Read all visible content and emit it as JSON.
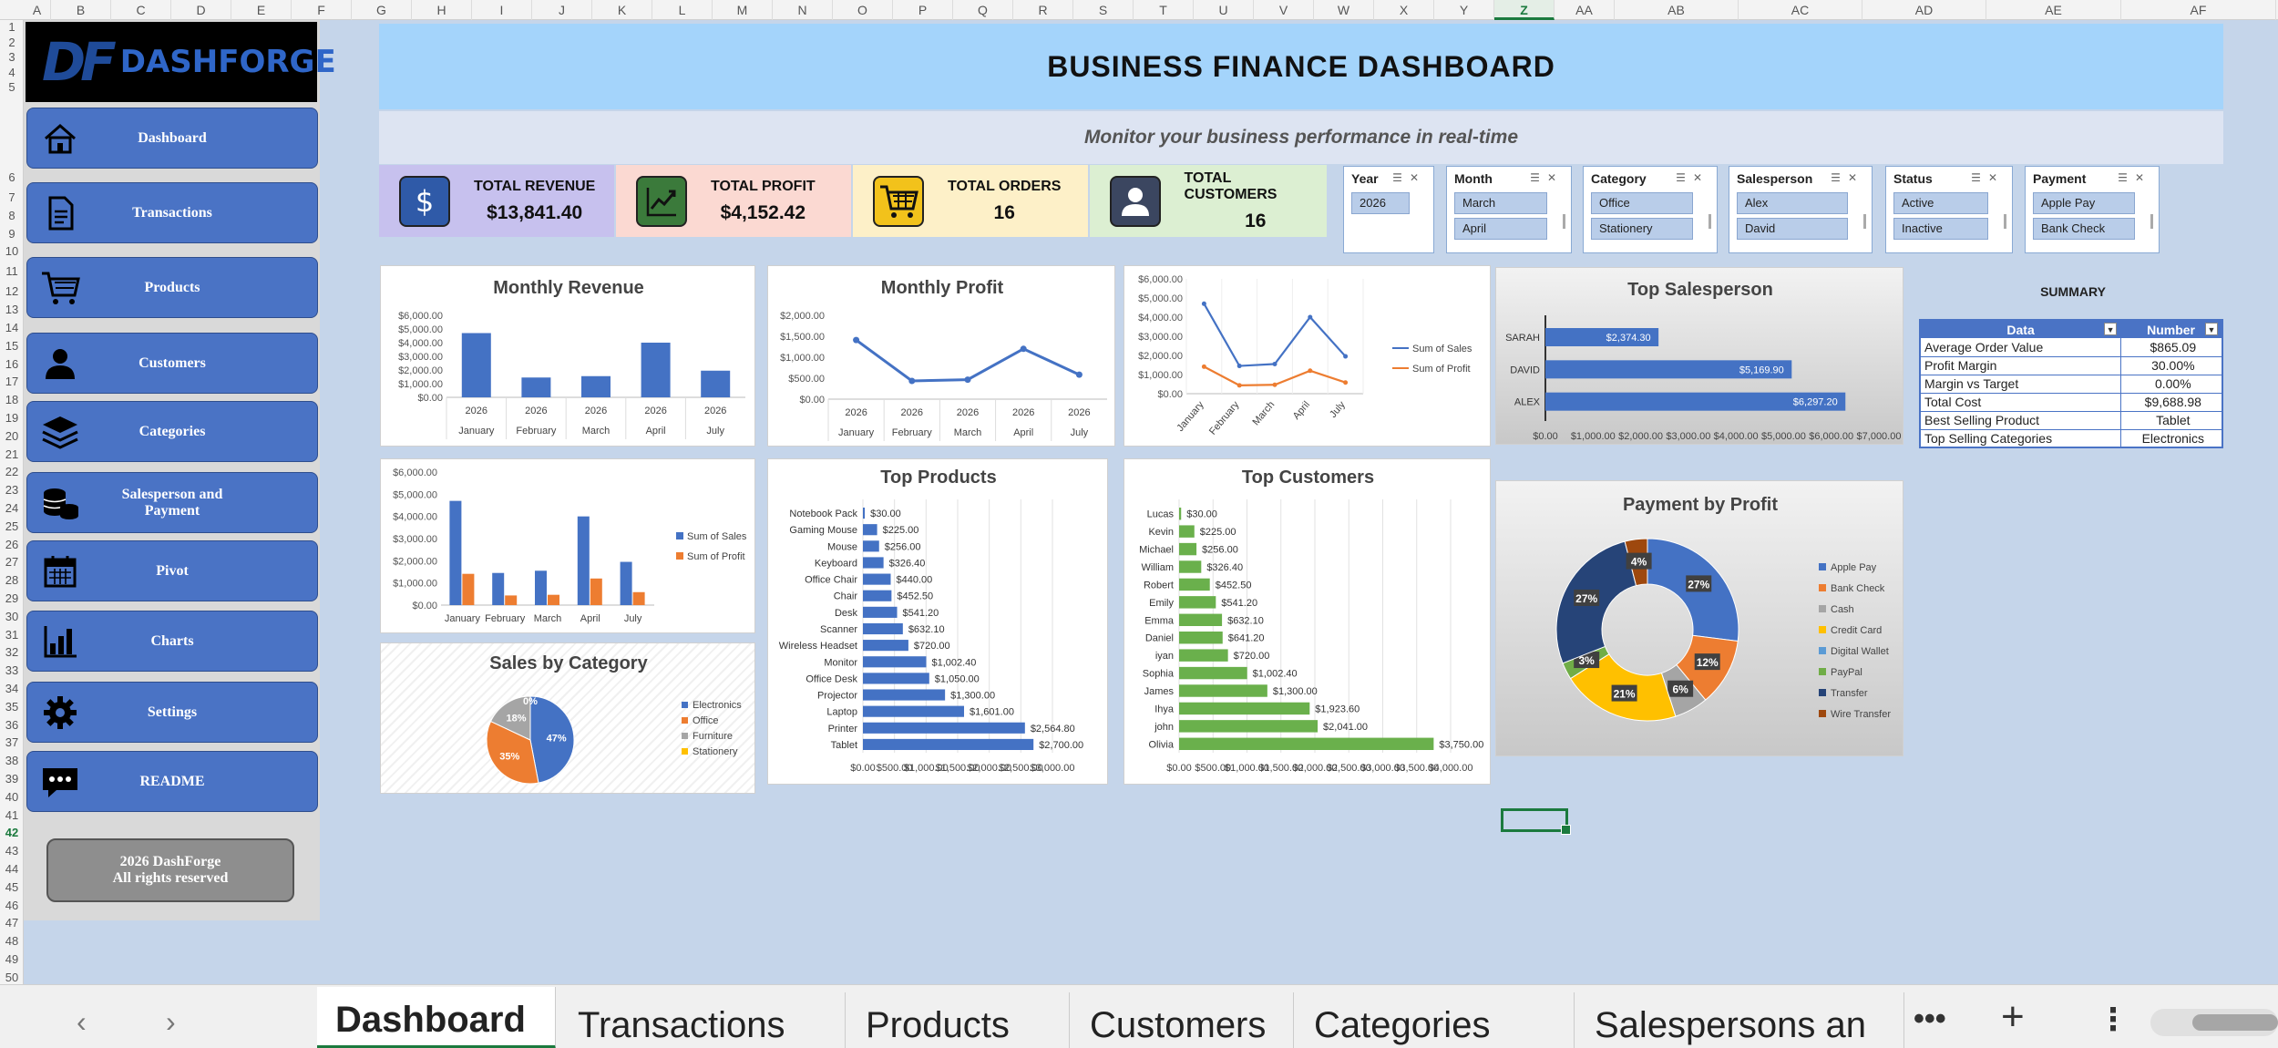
{
  "sheet": {
    "columns": [
      "A",
      "B",
      "C",
      "D",
      "E",
      "F",
      "G",
      "H",
      "I",
      "J",
      "K",
      "L",
      "M",
      "N",
      "O",
      "P",
      "Q",
      "R",
      "S",
      "T",
      "U",
      "V",
      "W",
      "X",
      "Y",
      "Z",
      "AA",
      "AB",
      "AC",
      "AD",
      "AE",
      "AF"
    ],
    "active_column": "Z",
    "rows": [
      "1",
      "2",
      "3",
      "4",
      "5",
      "6",
      "7",
      "8",
      "9",
      "10",
      "11",
      "12",
      "13",
      "14",
      "15",
      "16",
      "17",
      "18",
      "19",
      "20",
      "21",
      "22",
      "23",
      "24",
      "25",
      "26",
      "27",
      "28",
      "29",
      "30",
      "31",
      "32",
      "33",
      "34",
      "35",
      "36",
      "37",
      "38",
      "39",
      "40",
      "41",
      "42",
      "43",
      "44",
      "45",
      "46",
      "47",
      "48",
      "49",
      "50"
    ],
    "active_row": "42"
  },
  "logo": {
    "mark": "DF",
    "text": "DASHFORGE"
  },
  "nav": [
    {
      "label": "Dashboard",
      "icon": "home-icon"
    },
    {
      "label": "Transactions",
      "icon": "document-icon"
    },
    {
      "label": "Products",
      "icon": "cart-icon"
    },
    {
      "label": "Customers",
      "icon": "user-icon"
    },
    {
      "label": "Categories",
      "icon": "layers-icon"
    },
    {
      "label": "Salesperson and Payment",
      "icon": "coins-icon"
    },
    {
      "label": "Pivot",
      "icon": "calendar-icon"
    },
    {
      "label": "Charts",
      "icon": "bar-chart-icon"
    },
    {
      "label": "Settings",
      "icon": "gear-icon"
    },
    {
      "label": "README",
      "icon": "chat-icon"
    }
  ],
  "copyright": {
    "line1": "2026 DashForge",
    "line2": "All rights reserved"
  },
  "header": {
    "title": "BUSINESS FINANCE DASHBOARD",
    "subtitle": "Monitor your business performance in real-time"
  },
  "kpis": [
    {
      "label": "TOTAL REVENUE",
      "value": "$13,841.40",
      "bg": "#c7c1ee",
      "icon_bg": "#2f5aa8"
    },
    {
      "label": "TOTAL PROFIT",
      "value": "$4,152.42",
      "bg": "#fbd9d2",
      "icon_bg": "#3b7a3b"
    },
    {
      "label": "TOTAL ORDERS",
      "value": "16",
      "bg": "#fdf0c8",
      "icon_bg": "#f2c21b"
    },
    {
      "label": "TOTAL CUSTOMERS",
      "value": "16",
      "bg": "#dcefd2",
      "icon_bg": "#3b4660"
    }
  ],
  "slicers": [
    {
      "title": "Year",
      "items": [
        "2026"
      ]
    },
    {
      "title": "Month",
      "items": [
        "March",
        "April"
      ]
    },
    {
      "title": "Category",
      "items": [
        "Office",
        "Stationery"
      ]
    },
    {
      "title": "Salesperson",
      "items": [
        "Alex",
        "David"
      ]
    },
    {
      "title": "Status",
      "items": [
        "Active",
        "Inactive"
      ]
    },
    {
      "title": "Payment",
      "items": [
        "Apple Pay",
        "Bank Check"
      ]
    }
  ],
  "summary": {
    "title": "SUMMARY",
    "headers": [
      "Data",
      "Number"
    ],
    "rows": [
      [
        "Average Order Value",
        "$865.09"
      ],
      [
        "Profit Margin",
        "30.00%"
      ],
      [
        "Margin vs Target",
        "0.00%"
      ],
      [
        "Total Cost",
        "$9,688.98"
      ],
      [
        "Best Selling Product",
        "Tablet"
      ],
      [
        "Top Selling Categories",
        "Electronics"
      ]
    ]
  },
  "tabs": [
    "Dashboard",
    "Transactions",
    "Products",
    "Customers",
    "Categories",
    "Salespersons an"
  ],
  "tab_controls": {
    "prev": "‹",
    "next": "›",
    "more": "•••",
    "add": "+",
    "options": "⋮"
  },
  "colors": {
    "blue": "#4472c4",
    "orange": "#ed7d31",
    "grey": "#a5a5a5",
    "yellow": "#ffc000",
    "green": "#70ad47",
    "navy": "#264478",
    "brown": "#9e480e",
    "lightblue": "#5b9bd5"
  },
  "chart_data": [
    {
      "id": "monthly-revenue",
      "type": "bar",
      "title": "Monthly Revenue",
      "categories": [
        "January",
        "February",
        "March",
        "April",
        "July"
      ],
      "year_labels": [
        "2026",
        "2026",
        "2026",
        "2026",
        "2026"
      ],
      "values": [
        4700,
        1450,
        1550,
        4000,
        1950
      ],
      "ylim": [
        0,
        6000
      ],
      "yticks": [
        "$0.00",
        "$1,000.00",
        "$2,000.00",
        "$3,000.00",
        "$4,000.00",
        "$5,000.00",
        "$6,000.00"
      ]
    },
    {
      "id": "monthly-profit",
      "type": "line",
      "title": "Monthly Profit",
      "categories": [
        "January",
        "February",
        "March",
        "April",
        "July"
      ],
      "year_labels": [
        "2026",
        "2026",
        "2026",
        "2026",
        "2026"
      ],
      "values": [
        1410,
        435,
        465,
        1200,
        585
      ],
      "ylim": [
        0,
        2000
      ],
      "yticks": [
        "$0.00",
        "$500.00",
        "$1,000.00",
        "$1,500.00",
        "$2,000.00"
      ]
    },
    {
      "id": "sales-profit-line",
      "type": "line",
      "title": "",
      "categories": [
        "January",
        "February",
        "March",
        "April",
        "July"
      ],
      "series": [
        {
          "name": "Sum of Sales",
          "values": [
            4700,
            1450,
            1550,
            4000,
            1950
          ]
        },
        {
          "name": "Sum of Profit",
          "values": [
            1410,
            435,
            465,
            1200,
            585
          ]
        }
      ],
      "ylim": [
        0,
        6000
      ],
      "yticks": [
        "$0.00",
        "$1,000.00",
        "$2,000.00",
        "$3,000.00",
        "$4,000.00",
        "$5,000.00",
        "$6,000.00"
      ]
    },
    {
      "id": "top-salesperson",
      "type": "bar",
      "orientation": "horizontal",
      "title": "Top Salesperson",
      "categories": [
        "SARAH",
        "DAVID",
        "ALEX"
      ],
      "values": [
        2374.3,
        5169.9,
        6297.2
      ],
      "labels": [
        "$2,374.30",
        "$5,169.90",
        "$6,297.20"
      ],
      "xlim": [
        0,
        7000
      ],
      "xticks": [
        "$0.00",
        "$1,000.00",
        "$2,000.00",
        "$3,000.00",
        "$4,000.00",
        "$5,000.00",
        "$6,000.00",
        "$7,000.00"
      ]
    },
    {
      "id": "sales-profit-bar",
      "type": "bar",
      "title": "",
      "categories": [
        "January",
        "February",
        "March",
        "April",
        "July"
      ],
      "series": [
        {
          "name": "Sum of Sales",
          "values": [
            4700,
            1450,
            1550,
            4000,
            1950
          ]
        },
        {
          "name": "Sum of Profit",
          "values": [
            1410,
            435,
            465,
            1200,
            585
          ]
        }
      ],
      "ylim": [
        0,
        6000
      ],
      "yticks": [
        "$0.00",
        "$1,000.00",
        "$2,000.00",
        "$3,000.00",
        "$4,000.00",
        "$5,000.00",
        "$6,000.00"
      ]
    },
    {
      "id": "top-products",
      "type": "bar",
      "orientation": "horizontal",
      "title": "Top Products",
      "categories": [
        "Notebook Pack",
        "Gaming Mouse",
        "Mouse",
        "Keyboard",
        "Office Chair",
        "Chair",
        "Desk",
        "Scanner",
        "Wireless Headset",
        "Monitor",
        "Office Desk",
        "Projector",
        "Laptop",
        "Printer",
        "Tablet"
      ],
      "values": [
        30,
        225,
        256,
        326.4,
        440,
        452.5,
        541.2,
        632.1,
        720,
        1002.4,
        1050,
        1300,
        1601,
        2564.8,
        2700
      ],
      "labels": [
        "$30.00",
        "$225.00",
        "$256.00",
        "$326.40",
        "$440.00",
        "$452.50",
        "$541.20",
        "$632.10",
        "$720.00",
        "$1,002.40",
        "$1,050.00",
        "$1,300.00",
        "$1,601.00",
        "$2,564.80",
        "$2,700.00"
      ],
      "xlim": [
        0,
        3000
      ],
      "xticks": [
        "$0.00",
        "$500.00",
        "$1,000.00",
        "$1,500.00",
        "$2,000.00",
        "$2,500.00",
        "$3,000.00"
      ]
    },
    {
      "id": "top-customers",
      "type": "bar",
      "orientation": "horizontal",
      "title": "Top Customers",
      "categories": [
        "Lucas",
        "Kevin",
        "Michael",
        "William",
        "Robert",
        "Emily",
        "Emma",
        "Daniel",
        "iyan",
        "Sophia",
        "James",
        "Ihya",
        "john",
        "Olivia"
      ],
      "values": [
        30,
        225,
        256,
        326.4,
        452.5,
        541.2,
        632.1,
        641.2,
        720,
        1002.4,
        1300,
        1923.6,
        2041,
        3750
      ],
      "labels": [
        "$30.00",
        "$225.00",
        "$256.00",
        "$326.40",
        "$452.50",
        "$541.20",
        "$632.10",
        "$641.20",
        "$720.00",
        "$1,002.40",
        "$1,300.00",
        "$1,923.60",
        "$2,041.00",
        "$3,750.00"
      ],
      "xlim": [
        0,
        4000
      ],
      "xticks": [
        "$0.00",
        "$500.00",
        "$1,000.00",
        "$1,500.00",
        "$2,000.00",
        "$2,500.00",
        "$3,000.00",
        "$3,500.00",
        "$4,000.00"
      ]
    },
    {
      "id": "sales-by-category",
      "type": "pie",
      "title": "Sales by Category",
      "categories": [
        "Electronics",
        "Office",
        "Furniture",
        "Stationery"
      ],
      "values": [
        47,
        35,
        18,
        0
      ],
      "labels": [
        "47%",
        "35%",
        "18%",
        "0%"
      ]
    },
    {
      "id": "payment-by-profit",
      "type": "pie",
      "donut": true,
      "title": "Payment by Profit",
      "categories": [
        "Apple Pay",
        "Bank Check",
        "Cash",
        "Credit Card",
        "Digital Wallet",
        "PayPal",
        "Transfer",
        "Wire Transfer"
      ],
      "values": [
        27,
        12,
        6,
        21,
        0,
        3,
        27,
        4
      ],
      "labels": [
        "27%",
        "12%",
        "6%",
        "21%",
        "",
        "3%",
        "27%",
        "4%"
      ]
    }
  ]
}
